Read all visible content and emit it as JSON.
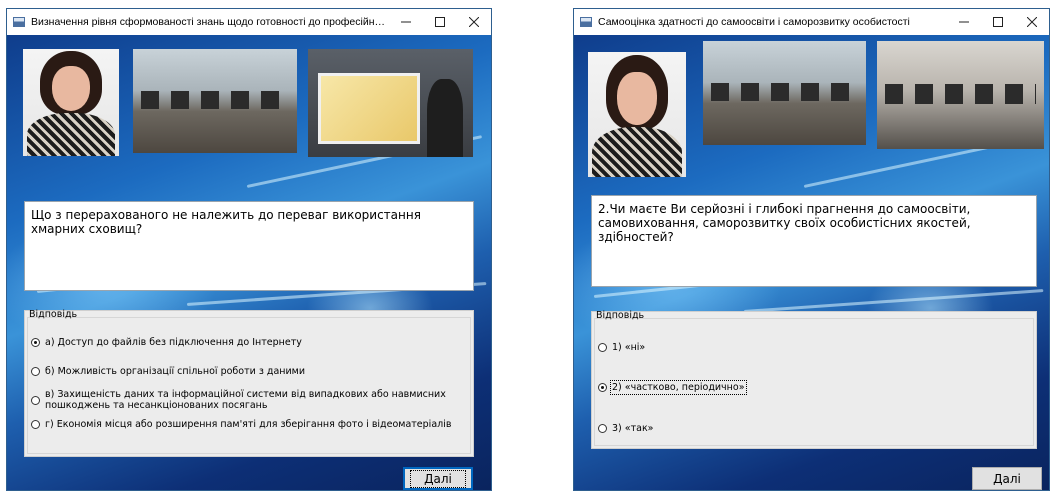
{
  "windows": [
    {
      "title": "Визначення рівня сформованості знань щодо готовності до професійної діяльності",
      "question": "Що з перерахованого не належить до переваг використання хмарних сховищ?",
      "answers_label": "Відповідь",
      "options": [
        {
          "text": "а) Доступ до файлів без підключення до Інтернету",
          "selected": true
        },
        {
          "text": "б) Можливість організації спільної роботи з даними",
          "selected": false
        },
        {
          "text": "в) Захищеність даних та інформаційної системи від випадкових або навмисних пошкоджень та несанкціонованих посягань",
          "selected": false
        },
        {
          "text": "г) Економія місця або розширення пам'яті для зберігання фото і відеоматеріалів",
          "selected": false
        }
      ],
      "next_label": "Далі"
    },
    {
      "title": "Самооцінка здатності до самоосвіти і саморозвитку особистості",
      "question": "2.Чи маєте Ви серйозні і глибокі прагнення до самоосвіти, самовиховання, саморозвитку своїх особистісних якостей, здібностей?",
      "answers_label": "Відповідь",
      "options": [
        {
          "text": "1) «ні»",
          "selected": false
        },
        {
          "text": "2) «частково, періодично»",
          "selected": true
        },
        {
          "text": "3) «так»",
          "selected": false
        }
      ],
      "next_label": "Далі"
    }
  ],
  "icons": {
    "minimize": "minimize-icon",
    "maximize": "maximize-icon",
    "close": "close-icon"
  },
  "colors": {
    "background_blue": "#1c6bc0",
    "focus_blue": "#0067c0"
  }
}
